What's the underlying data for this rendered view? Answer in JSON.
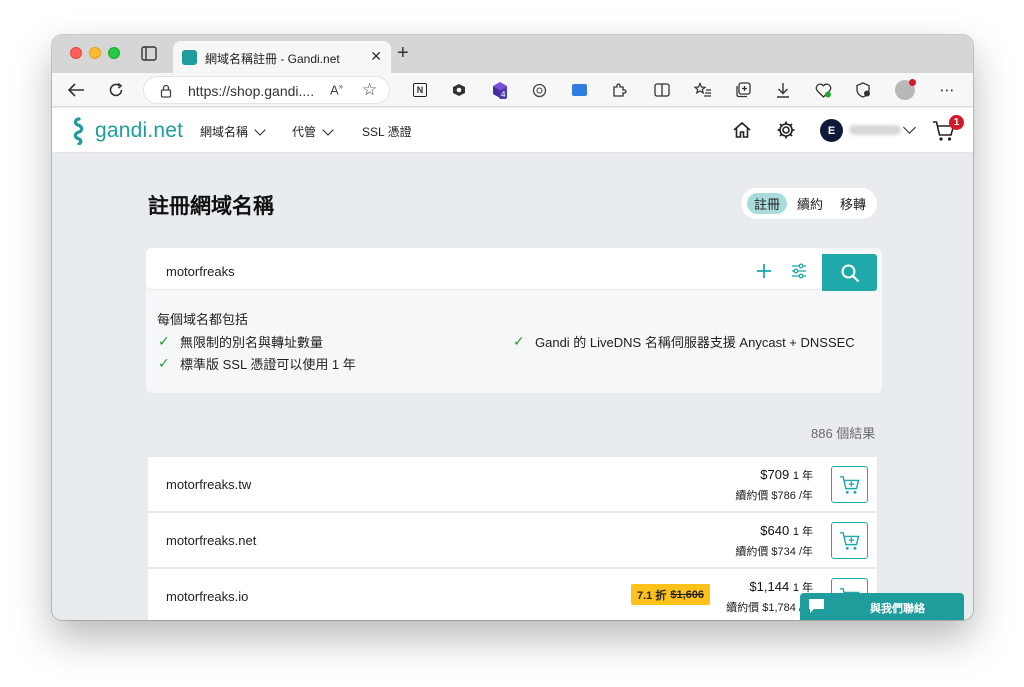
{
  "browser": {
    "tab_title": "網域名稱註冊 - Gandi.net",
    "address": "https://shop.gandi....",
    "extension_badge": "4"
  },
  "site": {
    "logo_text": "gandi.net",
    "nav": [
      {
        "label": "網域名稱"
      },
      {
        "label": "代管"
      },
      {
        "label": "SSL 憑證"
      }
    ],
    "account_initial": "E",
    "cart_count": "1"
  },
  "main": {
    "title": "註冊網域名稱",
    "modes": [
      "註冊",
      "續約",
      "移轉"
    ],
    "active_mode": "註冊",
    "search": {
      "value": "motorfreaks"
    },
    "includes_title": "每個域名都包括",
    "features": [
      "無限制的別名與轉址數量",
      "標準版 SSL 憑證可以使用 1 年",
      "Gandi 的 LiveDNS 名稱伺服器支援 Anycast + DNSSEC"
    ],
    "results_count": "886 個結果",
    "results": [
      {
        "domain": "motorfreaks.tw",
        "price": "$709",
        "period": "1 年",
        "renew": "續約價 $786 /年"
      },
      {
        "domain": "motorfreaks.net",
        "price": "$640",
        "period": "1 年",
        "renew": "續約價 $734 /年"
      },
      {
        "domain": "motorfreaks.io",
        "price": "$1,144",
        "period": "1 年",
        "renew": "續約價 $1,784 /年",
        "discount_label": "7.1 折",
        "original_price": "$1,606"
      }
    ]
  },
  "chat": {
    "label": "與我們聯絡"
  },
  "colors": {
    "brand": "#1f9c9c",
    "accent": "#1fa9ab",
    "discount": "#fdc21a",
    "badge": "#d3182b"
  }
}
